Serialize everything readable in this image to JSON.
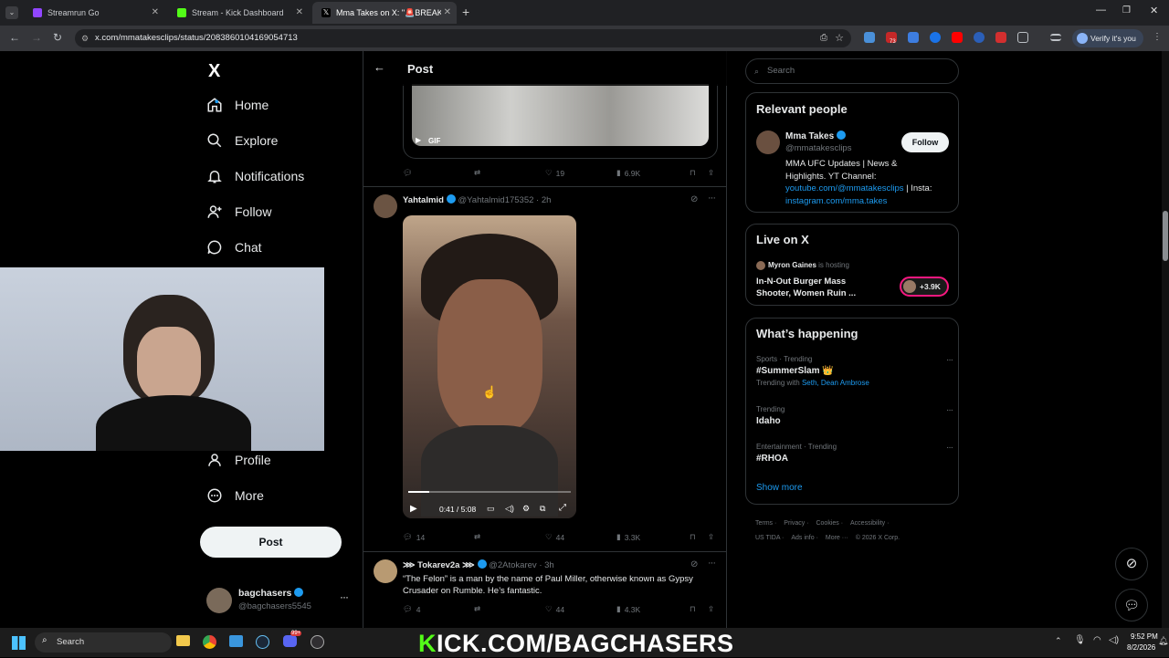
{
  "browser": {
    "tabs": [
      {
        "title": "Streamrun Go",
        "active": false
      },
      {
        "title": "Stream - Kick Dashboard",
        "active": false
      },
      {
        "title": "Mma Takes on X: \"🚨BREAKIN",
        "active": true
      }
    ],
    "url": "x.com/mmatakesclips/status/2083860104169054713",
    "profile_label": "Verify it's you",
    "badge_count": "73"
  },
  "sidebar": {
    "logo": "X",
    "items": [
      {
        "label": "Home",
        "icon": "home-icon"
      },
      {
        "label": "Explore",
        "icon": "search-icon"
      },
      {
        "label": "Notifications",
        "icon": "bell-icon"
      },
      {
        "label": "Follow",
        "icon": "person-add-icon"
      },
      {
        "label": "Chat",
        "icon": "chat-icon"
      },
      {
        "label": "Profile",
        "icon": "person-icon"
      },
      {
        "label": "More",
        "icon": "more-circle-icon"
      }
    ],
    "post_label": "Post",
    "account": {
      "name": "bagchasers",
      "handle": "@bagchasers5545"
    }
  },
  "main": {
    "header_title": "Post",
    "gif_label": "GIF",
    "post1_actions": {
      "replies": "",
      "reposts": "",
      "likes": "19",
      "views": "6.9K"
    },
    "post2": {
      "name": "Yahtalmid",
      "handle": "@Yahtalmid175352",
      "time": "· 2h",
      "video_time": "0:41 / 5:08",
      "video_progress": 0.13,
      "actions": {
        "replies": "14",
        "reposts": "",
        "likes": "44",
        "views": "3.3K"
      }
    },
    "post3": {
      "name": "⋙ Tokarev2a ⋙",
      "handle": "@2Atokarev",
      "time": "· 3h",
      "text": "“The Felon” is a man by the name of Paul Miller, otherwise known as Gypsy Crusader on Rumble. He’s fantastic.",
      "actions": {
        "replies": "4",
        "reposts": "",
        "likes": "44",
        "views": "4.3K"
      }
    }
  },
  "right": {
    "search_placeholder": "Search",
    "relevant": {
      "title": "Relevant people",
      "name": "Mma Takes",
      "handle": "@mmatakesclips",
      "follow_label": "Follow",
      "bio_1": "MMA UFC Updates | News &",
      "bio_2": "Highlights. YT Channel:",
      "bio_link": "youtube.com/@mmatakesclips",
      "bio_3": " | Insta:",
      "bio_link2": "instagram.com/mma.takes"
    },
    "live": {
      "title": "Live on X",
      "host": "Myron Gaines",
      "host_suffix": "is hosting",
      "line1": "In-N-Out Burger Mass",
      "line2": "Shooter, Women Ruin ...",
      "count": "+3.9K"
    },
    "happening": {
      "title": "What’s happening",
      "trends": [
        {
          "context": "Sports · Trending",
          "name": "#SummerSlam 👑",
          "with_label": "Trending with",
          "with": "Seth, Dean Ambrose"
        },
        {
          "context": "Trending",
          "name": "Idaho"
        },
        {
          "context": "Entertainment · Trending",
          "name": "#RHOA"
        }
      ],
      "show_more": "Show more"
    },
    "footer": {
      "line1": [
        "Terms",
        "Privacy",
        "Cookies",
        "Accessibility"
      ],
      "line2": [
        "US TIDA",
        "Ads info",
        "More ···",
        "© 2026 X Corp."
      ]
    }
  },
  "taskbar": {
    "search_label": "Search",
    "kick_k": "K",
    "kick_rest": "ICK.COM/BAGCHASERS",
    "time": "9:52 PM",
    "date": "8/2/2026",
    "discord_badge": "99+"
  }
}
